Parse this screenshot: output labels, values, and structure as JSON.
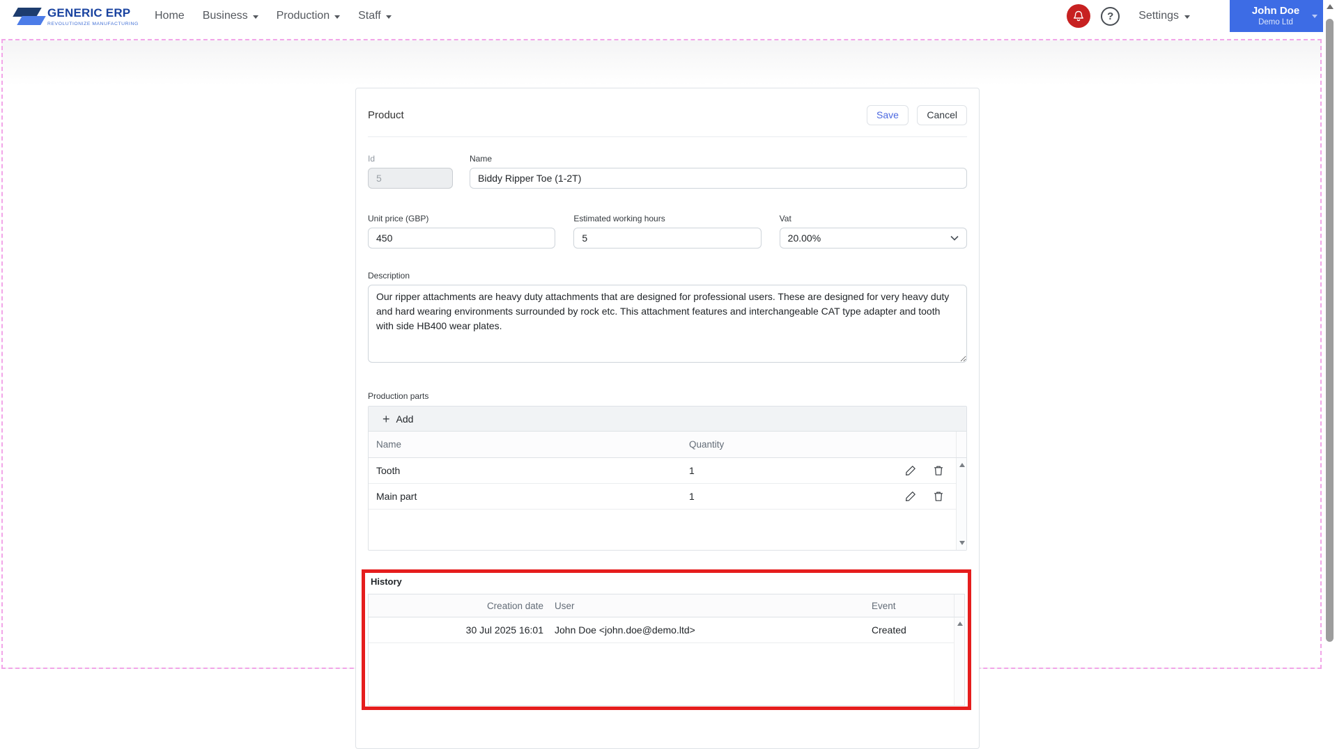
{
  "header": {
    "logo": {
      "title": "GENERIC ERP",
      "tagline": "REVOLUTIONIZE MANUFACTURING"
    },
    "nav": [
      {
        "label": "Home",
        "has_dropdown": false
      },
      {
        "label": "Business",
        "has_dropdown": true
      },
      {
        "label": "Production",
        "has_dropdown": true
      },
      {
        "label": "Staff",
        "has_dropdown": true
      }
    ],
    "help_glyph": "?",
    "settings_label": "Settings",
    "user": {
      "name": "John Doe",
      "company": "Demo Ltd"
    }
  },
  "form": {
    "title": "Product",
    "save_label": "Save",
    "cancel_label": "Cancel",
    "fields": {
      "id": {
        "label": "Id",
        "value": "5"
      },
      "name": {
        "label": "Name",
        "value": "Biddy Ripper Toe (1-2T)"
      },
      "unit_price": {
        "label": "Unit price (GBP)",
        "value": "450"
      },
      "estimated_hours": {
        "label": "Estimated working hours",
        "value": "5"
      },
      "vat": {
        "label": "Vat",
        "value": "20.00%"
      },
      "description": {
        "label": "Description",
        "value": "Our ripper attachments are heavy duty attachments that are designed for professional users. These are designed for very heavy duty and hard wearing environments surrounded by rock etc. This attachment features and interchangeable CAT type adapter and tooth with side HB400 wear plates."
      }
    }
  },
  "production_parts": {
    "label": "Production parts",
    "add_label": "Add",
    "add_glyph": "+",
    "columns": {
      "name": "Name",
      "quantity": "Quantity"
    },
    "rows": [
      {
        "name": "Tooth",
        "quantity": "1"
      },
      {
        "name": "Main part",
        "quantity": "1"
      }
    ]
  },
  "history": {
    "label": "History",
    "columns": {
      "creation_date": "Creation date",
      "user": "User",
      "event": "Event"
    },
    "rows": [
      {
        "creation_date": "30 Jul 2025 16:01",
        "user": "John Doe <john.doe@demo.ltd>",
        "event": "Created"
      }
    ]
  },
  "colors": {
    "highlight_red": "#e51d1d",
    "dashed_outline_pink": "#f2a5e8",
    "user_button_blue": "#3d6ce5",
    "bell_red": "#c72121",
    "save_blue": "#4b68e0",
    "logo_navy": "#1d3c6e",
    "logo_blue": "#4c7ce8"
  }
}
